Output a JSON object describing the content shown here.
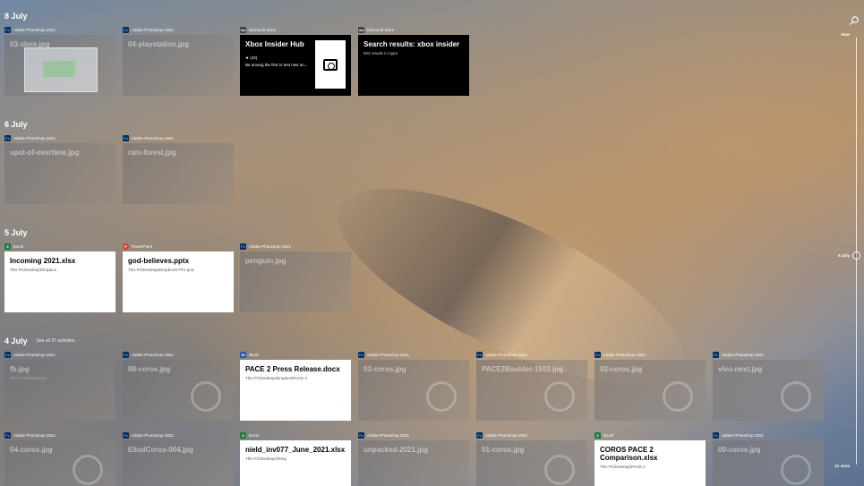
{
  "timeline": {
    "now_label": "Now",
    "current_label": "6 July",
    "end_label": "21 June"
  },
  "groups": [
    {
      "date": "8 July",
      "see_all": "",
      "tiles": [
        {
          "app": "Adobe Photoshop 2021",
          "icon": "Ps",
          "style": "photo",
          "title": "03-xbox.jpg",
          "path": ""
        },
        {
          "app": "Adobe Photoshop 2021",
          "icon": "Ps",
          "style": "photo",
          "title": "04-playstation.jpg",
          "path": ""
        },
        {
          "app": "Microsoft Store",
          "icon": "ms",
          "style": "black-store",
          "title": "Xbox Insider Hub",
          "rating": "★ (33)",
          "desc": "Be among the first to test new an..."
        },
        {
          "app": "Microsoft Store",
          "icon": "ms",
          "style": "black",
          "title": "Search results: xbox insider",
          "path": "503 results in Apps"
        }
      ]
    },
    {
      "date": "6 July",
      "see_all": "",
      "tiles": [
        {
          "app": "Adobe Photoshop 2021",
          "icon": "Ps",
          "style": "photo",
          "title": "spot-of-overtime.jpg",
          "path": ""
        },
        {
          "app": "Adobe Photoshop 2021",
          "icon": "Ps",
          "style": "photo",
          "title": "rain-forest.jpg",
          "path": ""
        }
      ]
    },
    {
      "date": "5 July",
      "see_all": "",
      "tiles": [
        {
          "app": "Excel",
          "icon": "X",
          "style": "white",
          "title": "Incoming 2021.xlsx",
          "path": "This PC\\Desktop\\Dropbox"
        },
        {
          "app": "PowerPoint",
          "icon": "P",
          "style": "white",
          "title": "god-believes.pptx",
          "path": "This PC\\Desktop\\Dropbox\\CTFA quiz"
        },
        {
          "app": "Adobe Photoshop 2021",
          "icon": "Ps",
          "style": "photo",
          "title": "penguin.jpg",
          "path": ""
        }
      ]
    },
    {
      "date": "4 July",
      "see_all": "See all 37 activities",
      "tiles": [
        {
          "app": "Adobe Photoshop 2021",
          "icon": "Ps",
          "style": "photo",
          "title": "fb.jpg",
          "path": "This PC\\Temp\\Temp"
        },
        {
          "app": "Adobe Photoshop 2021",
          "icon": "Ps",
          "style": "photo",
          "title": "08-coros.jpg",
          "path": ""
        },
        {
          "app": "Word",
          "icon": "W",
          "style": "white",
          "title": "PACE 2 Press Release.docx",
          "path": "This PC\\Desktop\\Dropbox\\PACE 2"
        },
        {
          "app": "Adobe Photoshop 2021",
          "icon": "Ps",
          "style": "photo",
          "title": "03-coros.jpg",
          "path": ""
        },
        {
          "app": "Adobe Photoshop 2021",
          "icon": "Ps",
          "style": "photo",
          "title": "PACE2Boulder-1502.jpg",
          "path": ""
        },
        {
          "app": "Adobe Photoshop 2021",
          "icon": "Ps",
          "style": "photo",
          "title": "02-coros.jpg",
          "path": ""
        },
        {
          "app": "Adobe Photoshop 2021",
          "icon": "Ps",
          "style": "photo",
          "title": "vivo-next.jpg",
          "path": ""
        }
      ]
    },
    {
      "date": "",
      "see_all": "",
      "tiles": [
        {
          "app": "Adobe Photoshop 2021",
          "icon": "Ps",
          "style": "photo",
          "title": "04-coros.jpg",
          "path": ""
        },
        {
          "app": "Adobe Photoshop 2021",
          "icon": "Ps",
          "style": "photo",
          "title": "EliudCoros-004.jpg",
          "path": ""
        },
        {
          "app": "Excel",
          "icon": "X",
          "style": "white",
          "title": "nield_inv077_June_2021.xlsx",
          "path": "This PC\\Desktop\\Temp"
        },
        {
          "app": "Adobe Photoshop 2021",
          "icon": "Ps",
          "style": "photo",
          "title": "unpacked-2021.jpg",
          "path": ""
        },
        {
          "app": "Adobe Photoshop 2021",
          "icon": "Ps",
          "style": "photo",
          "title": "01-coros.jpg",
          "path": ""
        },
        {
          "app": "Excel",
          "icon": "X",
          "style": "white",
          "title": "COROS PACE 2 Comparison.xlsx",
          "path": "This PC\\Desktop\\PACE 2"
        },
        {
          "app": "Adobe Photoshop 2021",
          "icon": "Ps",
          "style": "photo",
          "title": "00-coros.jpg",
          "path": ""
        }
      ]
    }
  ]
}
